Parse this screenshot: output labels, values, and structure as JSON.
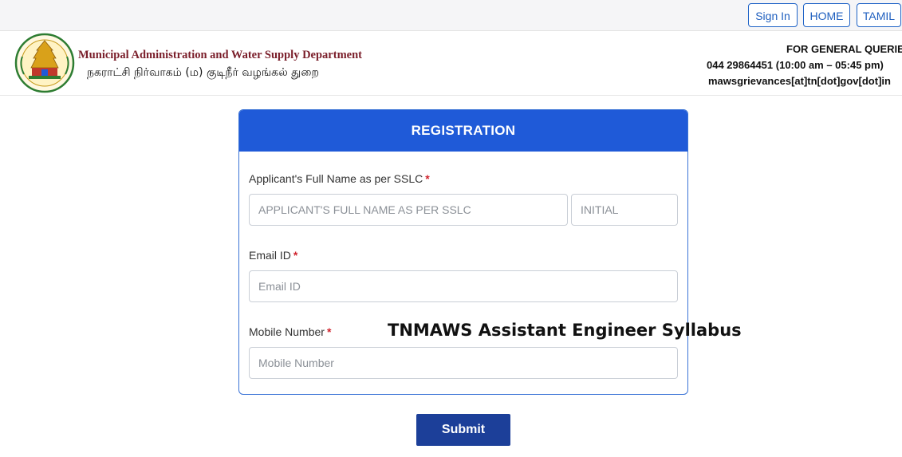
{
  "topbar": {
    "signin_label": "Sign In",
    "home_label": "HOME",
    "tamil_label": "TAMIL"
  },
  "header": {
    "dept_english": "Municipal Administration and Water Supply Department",
    "dept_tamil": "நகராட்சி நிர்வாகம் (ம) குடிநீர் வழங்கல் துறை",
    "contact_title": "FOR GENERAL QUERIES",
    "contact_phone": "044 29864451   (10:00 am – 05:45 pm)",
    "contact_email": "mawsgrievances[at]tn[dot]gov[dot]in",
    "logo_icon": "tamil-nadu-emblem-icon"
  },
  "form": {
    "title": "REGISTRATION",
    "name_label": "Applicant's Full Name as per SSLC",
    "name_placeholder": "APPLICANT'S FULL NAME AS PER SSLC",
    "initial_placeholder": "INITIAL",
    "email_label": "Email ID",
    "email_placeholder": "Email ID",
    "mobile_label": "Mobile Number",
    "mobile_placeholder": "Mobile Number",
    "required_mark": "*",
    "submit_label": "Submit"
  },
  "overlay_text": "TNMAWS Assistant Engineer Syllabus",
  "colors": {
    "primary": "#1f5ad8",
    "submit": "#1c3f99",
    "required": "#d0242e",
    "dept_title": "#7a1e2a"
  }
}
